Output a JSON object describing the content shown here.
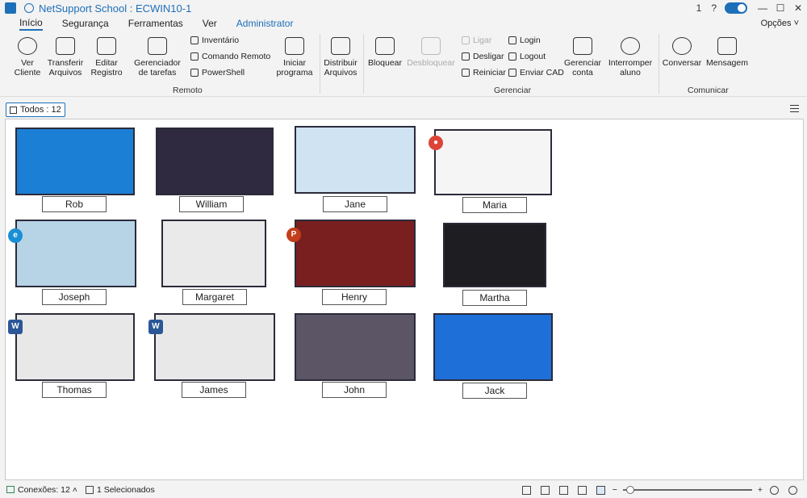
{
  "titlebar": {
    "title": "NetSupport School : ECWIN10-1",
    "notif_count": "1",
    "help": "?",
    "min": "—",
    "max": "☐",
    "close": "✕"
  },
  "menu": {
    "tabs": [
      "Início",
      "Segurança",
      "Ferramentas",
      "Ver",
      "Administrator"
    ],
    "options": "Opções"
  },
  "ribbon": {
    "ver_cliente": "Ver Cliente",
    "transferir": "Transferir Arquivos",
    "editar": "Editar Registro",
    "gerenciador": "Gerenciador de tarefas",
    "inventario": "Inventário",
    "comando": "Comando Remoto",
    "powershell": "PowerShell",
    "iniciar": "Iniciar programa",
    "distribuir": "Distribuir Arquivos",
    "bloquear": "Bloquear",
    "desbloquear": "Desbloquear",
    "ligar": "Ligar",
    "desligar": "Desligar",
    "reiniciar": "Reiniciar",
    "login": "Login",
    "logout": "Logout",
    "enviar_cad": "Enviar CAD",
    "gerenciar_conta": "Gerenciar conta",
    "interromper": "Interromper aluno",
    "conversar": "Conversar",
    "mensagem": "Mensagem",
    "groups": {
      "remoto": "Remoto",
      "gerenciar": "Gerenciar",
      "comunicar": "Comunicar"
    }
  },
  "filter": {
    "todos": "Todos : 12"
  },
  "clients": [
    {
      "name": "Rob",
      "bg": "#1b7fd6"
    },
    {
      "name": "William",
      "bg": "#2f2a3f"
    },
    {
      "name": "Jane",
      "bg": "#cfe3f3"
    },
    {
      "name": "Maria",
      "bg": "#f5f5f5"
    },
    {
      "name": "Joseph",
      "bg": "#b7d3e6"
    },
    {
      "name": "Margaret",
      "bg": "#eaeaea"
    },
    {
      "name": "Henry",
      "bg": "#7a1f1f"
    },
    {
      "name": "Martha",
      "bg": "#1d1d22"
    },
    {
      "name": "Thomas",
      "bg": "#e8e8e8"
    },
    {
      "name": "James",
      "bg": "#e8e8e8"
    },
    {
      "name": "John",
      "bg": "#5b5566"
    },
    {
      "name": "Jack",
      "bg": "#1e6fd8"
    }
  ],
  "status": {
    "connections": "Conexões: 12",
    "selected": "1 Selecionados"
  }
}
